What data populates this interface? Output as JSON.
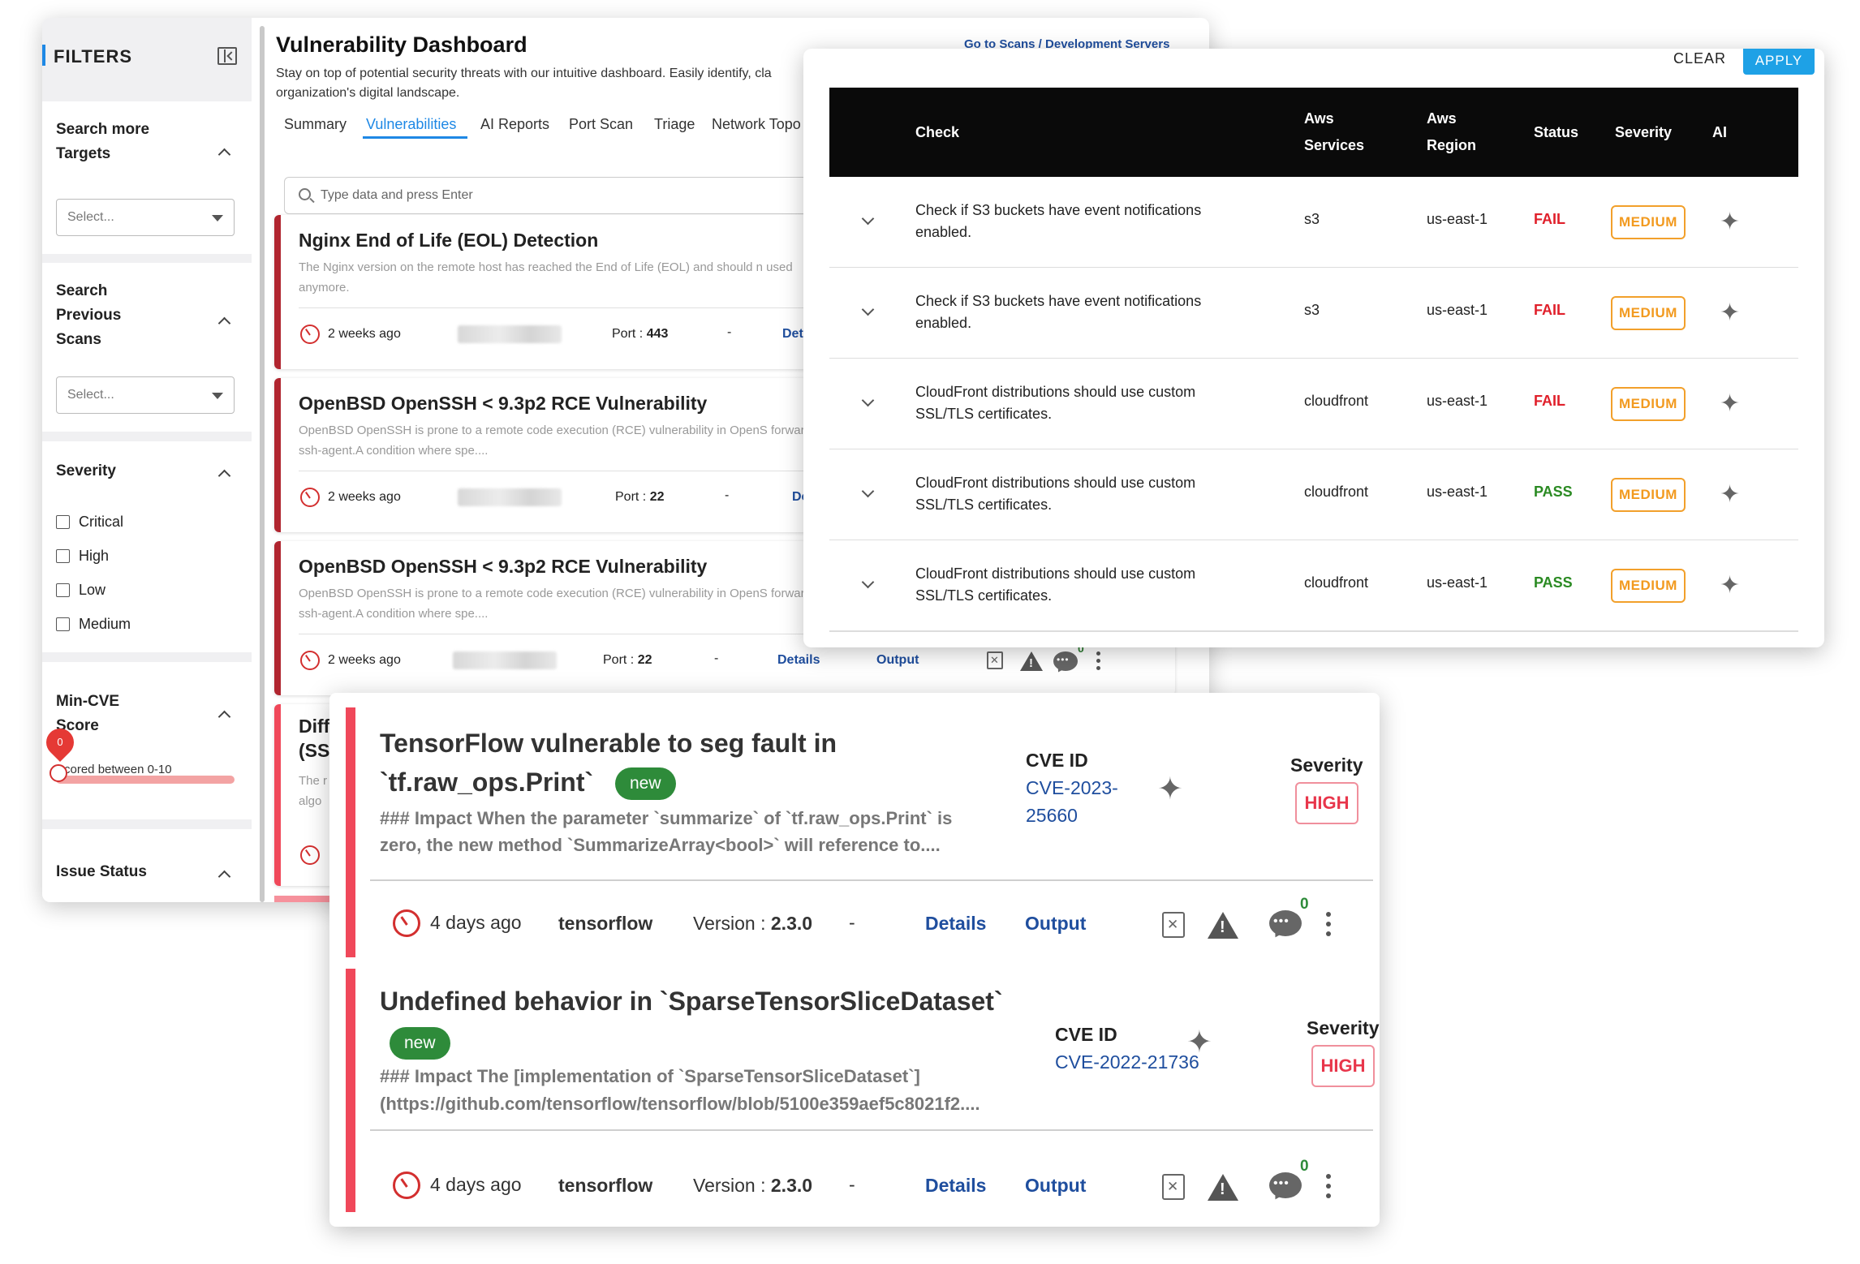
{
  "dashboard": {
    "filters_title": "FILTERS",
    "sidebar": {
      "targets": {
        "label": "Search more Targets",
        "placeholder": "Select..."
      },
      "previous_scans": {
        "label": "Search Previous Scans",
        "placeholder": "Select..."
      },
      "severity": {
        "label": "Severity",
        "options": [
          "Critical",
          "High",
          "Low",
          "Medium"
        ]
      },
      "min_cve": {
        "label": "Min-CVE Score",
        "hint": "Scored between 0-10",
        "value": "0"
      },
      "issue_status": {
        "label": "Issue Status"
      }
    },
    "title": "Vulnerability Dashboard",
    "subtitle": "Stay on top of potential security threats with our intuitive dashboard. Easily identify, cla organization's digital landscape.",
    "goto_link": "Go to Scans / Development Servers",
    "tabs": [
      "Summary",
      "Vulnerabilities",
      "AI Reports",
      "Port Scan",
      "Triage",
      "Network Topo"
    ],
    "active_tab": "Vulnerabilities",
    "search_placeholder": "Type data and press Enter",
    "cards": [
      {
        "title": "Nginx End of Life (EOL) Detection",
        "description": "The Nginx version on the remote host has reached the End of Life (EOL) and should n used anymore.",
        "ago": "2 weeks ago",
        "port_label": "Port :",
        "port": "443",
        "dash": "-",
        "details": "Deta",
        "accent": "#b0252f"
      },
      {
        "title": "OpenBSD OpenSSH < 9.3p2 RCE Vulnerability",
        "description": "OpenBSD OpenSSH is prone to a remote code execution (RCE) vulnerability in OpenS forwarded ssh-agent.A condition where spe....",
        "ago": "2 weeks ago",
        "port_label": "Port :",
        "port": "22",
        "dash": "-",
        "details": "Deta",
        "accent": "#b0252f"
      },
      {
        "title": "OpenBSD OpenSSH < 9.3p2 RCE Vulnerability",
        "description": "OpenBSD OpenSSH is prone to a remote code execution (RCE) vulnerability in OpenS forwarded ssh-agent.A condition where spe....",
        "ago": "2 weeks ago",
        "port_label": "Port :",
        "port": "22",
        "dash": "-",
        "details": "Details",
        "output": "Output",
        "comment_count": "0",
        "accent": "#b0252f"
      },
      {
        "title_line1": "Diff",
        "title_line2": "(SS",
        "desc_line1": "The r",
        "desc_line2": "algo",
        "accent": "#f0485a"
      }
    ]
  },
  "checks": {
    "clear": "CLEAR",
    "apply": "APPLY",
    "headers": {
      "check": "Check",
      "aws_services_1": "Aws",
      "aws_services_2": "Services",
      "aws_region_1": "Aws",
      "aws_region_2": "Region",
      "status": "Status",
      "severity": "Severity",
      "ai": "AI"
    },
    "rows": [
      {
        "check": "Check if S3 buckets have event notifications enabled.",
        "service": "s3",
        "region": "us-east-1",
        "status": "FAIL",
        "severity": "MEDIUM"
      },
      {
        "check": "Check if S3 buckets have event notifications enabled.",
        "service": "s3",
        "region": "us-east-1",
        "status": "FAIL",
        "severity": "MEDIUM"
      },
      {
        "check": "CloudFront distributions should use custom SSL/TLS certificates.",
        "service": "cloudfront",
        "region": "us-east-1",
        "status": "FAIL",
        "severity": "MEDIUM"
      },
      {
        "check": "CloudFront distributions should use custom SSL/TLS certificates.",
        "service": "cloudfront",
        "region": "us-east-1",
        "status": "PASS",
        "severity": "MEDIUM"
      },
      {
        "check": "CloudFront distributions should use custom SSL/TLS certificates.",
        "service": "cloudfront",
        "region": "us-east-1",
        "status": "PASS",
        "severity": "MEDIUM"
      }
    ],
    "colors": {
      "fail": "#e0202b",
      "pass": "#2a8a22",
      "medium": "#f29a1f"
    }
  },
  "tf_cards": [
    {
      "title_line1": "TensorFlow vulnerable to seg fault in",
      "title_line2": "`tf.raw_ops.Print`",
      "badge": "new",
      "desc_line1": "### Impact When the parameter `summarize` of `tf.raw_ops.Print` is",
      "desc_line2": "zero, the new method `SummarizeArray<bool>` will reference to....",
      "cve_label": "CVE ID",
      "cve_line1": "CVE-2023-",
      "cve_line2": "25660",
      "severity_label": "Severity",
      "severity": "HIGH",
      "ago": "4 days ago",
      "package": "tensorflow",
      "version_label": "Version :",
      "version": "2.3.0",
      "dash": "-",
      "details": "Details",
      "output": "Output",
      "comment_count": "0"
    },
    {
      "title_line1": "Undefined behavior in `SparseTensorSliceDataset`",
      "badge": "new",
      "desc_line1": "### Impact The [implementation of `SparseTensorSliceDataset`]",
      "desc_line2": "(https://github.com/tensorflow/tensorflow/blob/5100e359aef5c8021f2....",
      "cve_label": "CVE ID",
      "cve_line1": "CVE-2022-21736",
      "severity_label": "Severity",
      "severity": "HIGH",
      "ago": "4 days ago",
      "package": "tensorflow",
      "version_label": "Version :",
      "version": "2.3.0",
      "dash": "-",
      "details": "Details",
      "output": "Output",
      "comment_count": "0"
    }
  ]
}
